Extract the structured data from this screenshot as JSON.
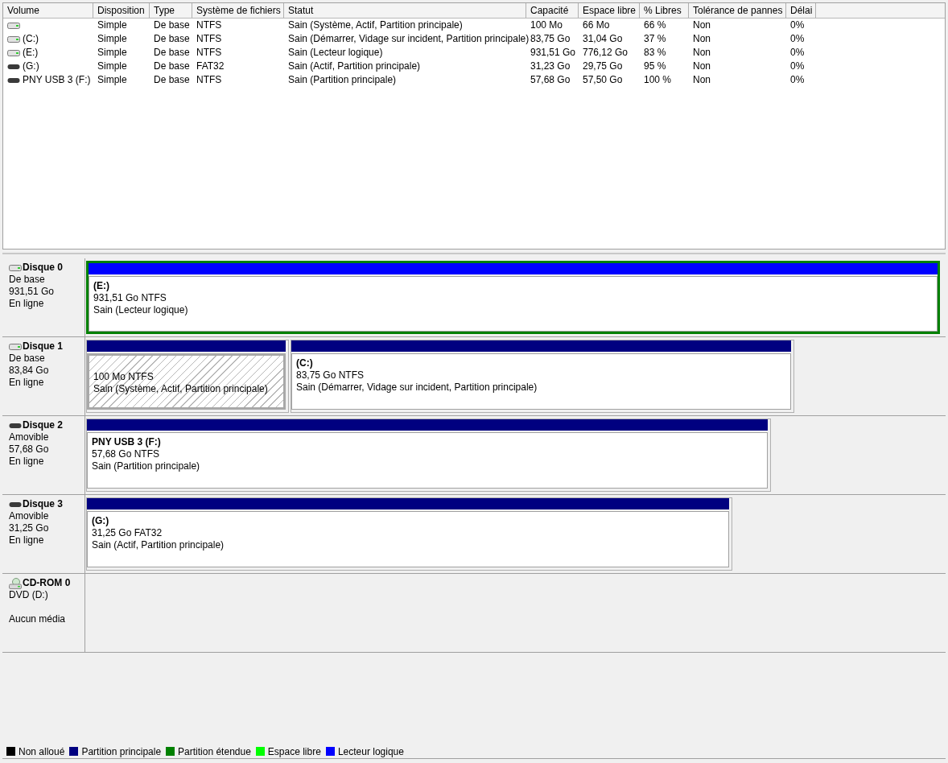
{
  "table": {
    "columns": [
      "Volume",
      "Disposition",
      "Type",
      "Système de fichiers",
      "Statut",
      "Capacité",
      "Espace libre",
      "% Libres",
      "Tolérance de pannes",
      "Délai"
    ],
    "rows": [
      {
        "kind": "hdd",
        "cells": [
          null,
          "Simple",
          "De base",
          "NTFS",
          "Sain (Système, Actif, Partition principale)",
          "100 Mo",
          "66 Mo",
          "66 %",
          "Non",
          "0%"
        ]
      },
      {
        "kind": "hdd",
        "cells": [
          "(C:)",
          "Simple",
          "De base",
          "NTFS",
          "Sain (Démarrer, Vidage sur incident, Partition principale)",
          "83,75 Go",
          "31,04 Go",
          "37 %",
          "Non",
          "0%"
        ]
      },
      {
        "kind": "hdd",
        "cells": [
          "(E:)",
          "Simple",
          "De base",
          "NTFS",
          "Sain (Lecteur logique)",
          "931,51 Go",
          "776,12 Go",
          "83 %",
          "Non",
          "0%"
        ]
      },
      {
        "kind": "removable",
        "cells": [
          "(G:)",
          "Simple",
          "De base",
          "FAT32",
          "Sain (Actif, Partition principale)",
          "31,23 Go",
          "29,75 Go",
          "95 %",
          "Non",
          "0%"
        ]
      },
      {
        "kind": "removable",
        "cells": [
          "PNY USB 3 (F:)",
          "Simple",
          "De base",
          "NTFS",
          "Sain (Partition principale)",
          "57,68 Go",
          "57,50 Go",
          "100 %",
          "Non",
          "0%"
        ]
      }
    ]
  },
  "disks": [
    {
      "kind": "hdd",
      "name": "Disque 0",
      "lines": [
        "De base",
        "931,51 Go",
        "En ligne"
      ],
      "partitions": [
        {
          "kind": "logical",
          "extended": true,
          "selected": false,
          "title": "(E:)",
          "size": "931,51 Go NTFS",
          "status": "Sain (Lecteur logique)"
        }
      ]
    },
    {
      "kind": "hdd",
      "name": "Disque 1",
      "lines": [
        "De base",
        "83,84 Go",
        "En ligne"
      ],
      "partitions": [
        {
          "kind": "primary",
          "extended": false,
          "selected": true,
          "size": "100 Mo NTFS",
          "status": "Sain (Système, Actif, Partition principale)"
        },
        {
          "kind": "primary",
          "extended": false,
          "selected": false,
          "title": "(C:)",
          "size": "83,75 Go NTFS",
          "status": "Sain (Démarrer, Vidage sur incident, Partition principale)"
        }
      ]
    },
    {
      "kind": "removable",
      "name": "Disque 2",
      "lines": [
        "Amovible",
        "57,68 Go",
        "En ligne"
      ],
      "partitions": [
        {
          "kind": "primary",
          "extended": false,
          "selected": false,
          "title": "PNY USB 3  (F:)",
          "size": "57,68 Go NTFS",
          "status": "Sain (Partition principale)"
        }
      ]
    },
    {
      "kind": "removable",
      "name": "Disque 3",
      "lines": [
        "Amovible",
        "31,25 Go",
        "En ligne"
      ],
      "partitions": [
        {
          "kind": "primary",
          "extended": false,
          "selected": false,
          "title": "(G:)",
          "size": "31,25 Go FAT32",
          "status": "Sain (Actif, Partition principale)"
        }
      ]
    },
    {
      "kind": "cdrom",
      "name": "CD-ROM 0",
      "lines": [
        "DVD (D:)",
        "Aucun média"
      ]
    }
  ],
  "legend": [
    {
      "label": "Non alloué",
      "color": "#000000"
    },
    {
      "label": "Partition principale",
      "color": "#000080"
    },
    {
      "label": "Partition étendue",
      "color": "#008000"
    },
    {
      "label": "Espace libre",
      "color": "#00ff00"
    },
    {
      "label": "Lecteur logique",
      "color": "#0000ff"
    }
  ]
}
